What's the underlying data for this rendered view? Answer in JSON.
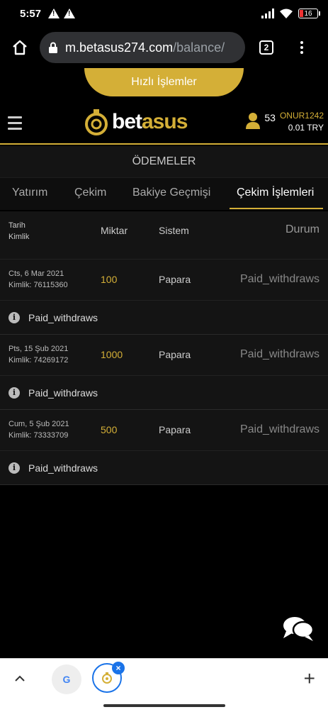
{
  "status_bar": {
    "time": "5:57",
    "battery": "16"
  },
  "browser": {
    "url_host": "m.betasus274.com",
    "url_path": "/balance/",
    "tab_count": "2"
  },
  "site": {
    "quick_actions": "Hızlı İşlemler",
    "logo_prefix": "bet",
    "logo_suffix": "asus",
    "user_count": "53",
    "username": "ONUR1242",
    "balance": "0.01 TRY"
  },
  "page": {
    "title": "ÖDEMELER",
    "tabs": [
      "Yatırım",
      "Çekim",
      "Bakiye Geçmişi",
      "Çekim İşlemleri"
    ],
    "active_tab": "Çekim İşlemleri"
  },
  "table": {
    "headers": {
      "date": "Tarih",
      "id": "Kimlik",
      "amount": "Miktar",
      "system": "Sistem",
      "status": "Durum"
    },
    "rows": [
      {
        "date": "Cts, 6 Mar 2021",
        "id": "Kimlik: 76115360",
        "amount": "100",
        "system": "Papara",
        "status": "Paid_withdraws",
        "note": "Paid_withdraws"
      },
      {
        "date": "Pts, 15 Şub 2021",
        "id": "Kimlik: 74269172",
        "amount": "1000",
        "system": "Papara",
        "status": "Paid_withdraws",
        "note": "Paid_withdraws"
      },
      {
        "date": "Cum, 5 Şub 2021",
        "id": "Kimlik: 73333709",
        "amount": "500",
        "system": "Papara",
        "status": "Paid_withdraws",
        "note": "Paid_withdraws"
      }
    ]
  },
  "bottom_bar": {
    "google_label": "G",
    "plus": "+",
    "close": "×"
  },
  "colors": {
    "accent": "#d4af37",
    "background": "#000000",
    "panel": "#141414"
  }
}
